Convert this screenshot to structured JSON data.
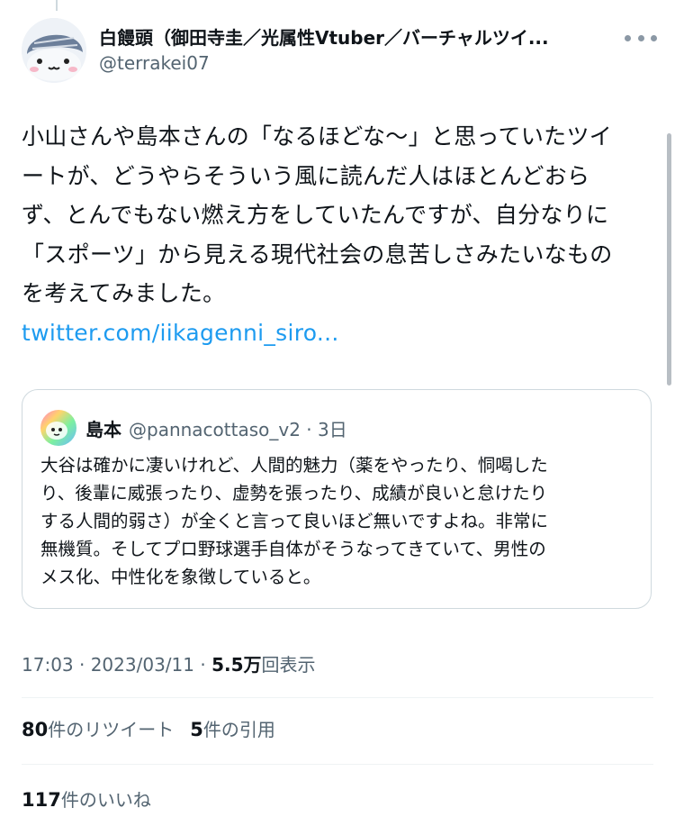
{
  "tweet": {
    "author_name": "白饅頭（御田寺圭／光属性Vtuber／バーチャルツイ...",
    "author_handle": "@terrakei07",
    "text_lines": [
      "小山さんや島本さんの「なるほどな〜」と思っていたツイ",
      "ートが、どうやらそういう風に読んだ人はほとんどおら",
      "ず、とんでもない燃え方をしていたんですが、自分なりに",
      "「スポーツ」から見える現代社会の息苦しさみたいなもの",
      "を考えてみました。"
    ],
    "link": "twitter.com/iikagenni_siro..."
  },
  "quote": {
    "name": "島本",
    "handle_time": "@pannacottaso_v2 · 3日",
    "text_lines": [
      "大谷は確かに凄いけれど、人間的魅力（薬をやったり、恫喝した",
      "り、後輩に威張ったり、虚勢を張ったり、成績が良いと怠けたり",
      "する人間的弱さ）が全くと言って良いほど無いですよね。非常に",
      "無機質。そしてプロ野球選手自体がそうなってきていて、男性の",
      "メス化、中性化を象徴していると。"
    ]
  },
  "meta": {
    "time": "17:03 · 2023/03/11 · ",
    "views_count": "5.5万",
    "views_label": "回表示"
  },
  "stats": {
    "retweets_count": "80",
    "retweets_label": "件のリツイート",
    "quotes_count": "5",
    "quotes_label": "件の引用",
    "likes_count": "117",
    "likes_label": "件のいいね"
  },
  "colors": {
    "link": "#1d9bf0",
    "secondary_text": "#536471",
    "primary_text": "#0f1419",
    "border": "#cfd9de"
  },
  "icons": {
    "more": "more-horizontal-icon"
  }
}
